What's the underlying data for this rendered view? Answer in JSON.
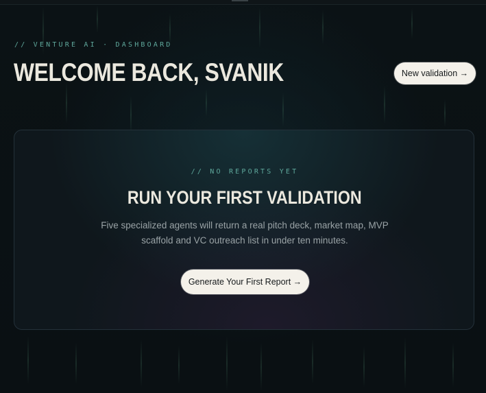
{
  "header": {
    "eyebrow": "// VENTURE AI · DASHBOARD",
    "title": "WELCOME BACK, SVANIK",
    "new_validation_label": "New validation →"
  },
  "empty_state": {
    "eyebrow": "// NO REPORTS YET",
    "title": "RUN YOUR FIRST VALIDATION",
    "description": "Five specialized agents will return a real pitch deck, market map, MVP scaffold and VC outreach list in under ten minutes.",
    "cta_label": "Generate Your First Report →"
  },
  "colors": {
    "background": "#0a1013",
    "accent": "#5fa89c",
    "heading": "#ebe8de",
    "button_bg": "#f4f1ea"
  }
}
